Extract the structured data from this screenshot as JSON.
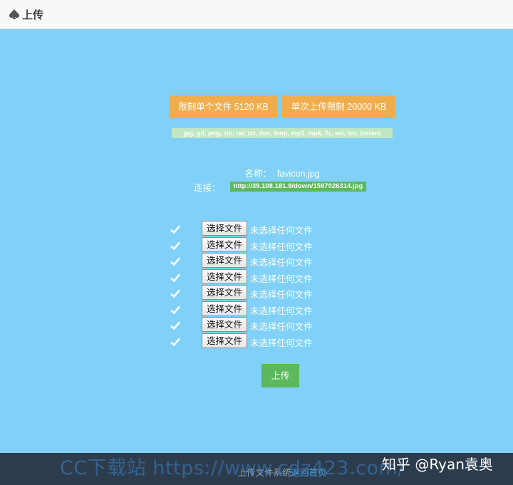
{
  "header": {
    "title": "上传",
    "icon": "spade-icon"
  },
  "limits": {
    "single_file": "限制单个文件 5120 KB",
    "per_upload": "单次上传限制 20000 KB",
    "allowed_types": "jpg, gif, png, zip, rar, txt, doc, bmp, mp3, mp4, 7z, avi, ico, torrent"
  },
  "result": {
    "name_label": "名称：",
    "name_value": "favicon.jpg",
    "link_label": "连接：",
    "link_value": "http://39.108.181.9/down/1597026314.jpg"
  },
  "file_inputs": [
    {
      "button": "选择文件",
      "status": "未选择任何文件"
    },
    {
      "button": "选择文件",
      "status": "未选择任何文件"
    },
    {
      "button": "选择文件",
      "status": "未选择任何文件"
    },
    {
      "button": "选择文件",
      "status": "未选择任何文件"
    },
    {
      "button": "选择文件",
      "status": "未选择任何文件"
    },
    {
      "button": "选择文件",
      "status": "未选择任何文件"
    },
    {
      "button": "选择文件",
      "status": "未选择任何文件"
    },
    {
      "button": "选择文件",
      "status": "未选择任何文件"
    }
  ],
  "submit_label": "上传",
  "footer": {
    "text": "上传文件系统",
    "home_link": "返回首页"
  },
  "watermark": "CC下载站  https://www.cdz423.com/",
  "credit": "知乎 @Ryan袁奥",
  "colors": {
    "background": "#80d0f8",
    "limit_badge": "#f0ad4e",
    "success": "#5cb85c",
    "footer": "#2d3c4c"
  }
}
